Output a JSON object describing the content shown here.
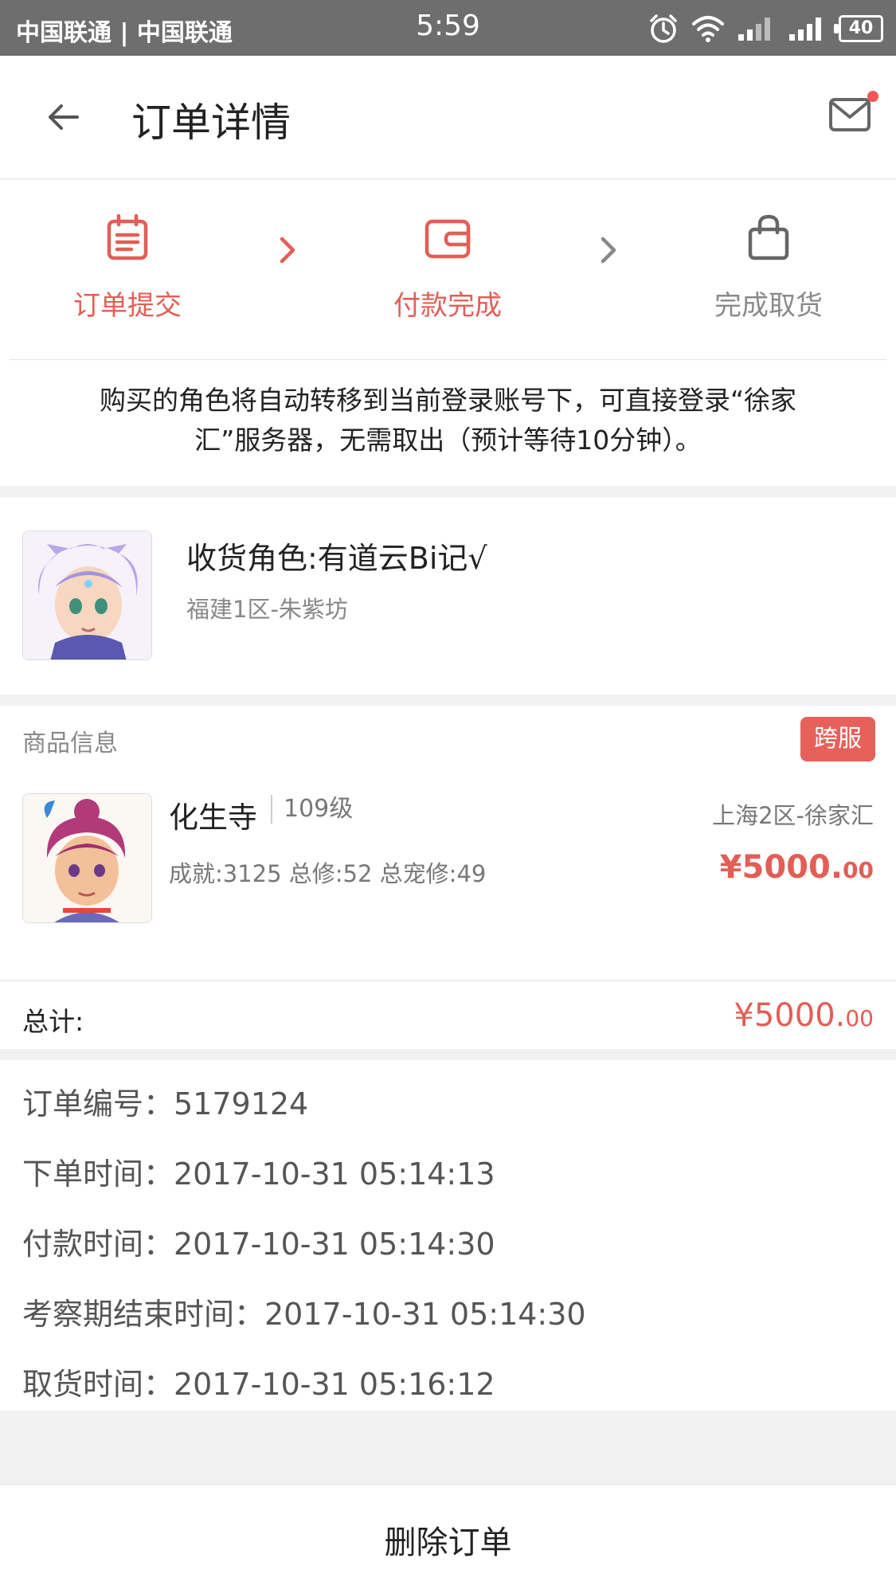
{
  "status_bar": {
    "carrier": "中国联通 | 中国联通",
    "time": "5:59",
    "battery": "40"
  },
  "header": {
    "title": "订单详情"
  },
  "steps": [
    {
      "label": "订单提交",
      "icon": "calendar-icon",
      "state": "active"
    },
    {
      "label": "付款完成",
      "icon": "wallet-icon",
      "state": "active"
    },
    {
      "label": "完成取货",
      "icon": "bag-icon",
      "state": "inactive"
    }
  ],
  "notice": {
    "line1": "购买的角色将自动转移到当前登录账号下，可直接登录“徐家",
    "line2": "汇”服务器，无需取出（预计等待10分钟）。"
  },
  "receiver": {
    "name": "收货角色:有道云Bi记√",
    "server": "福建1区-朱紫坊"
  },
  "goods": {
    "section_title": "商品信息",
    "badge": "跨服",
    "name": "化生寺",
    "level": "109级",
    "server": "上海2区-徐家汇",
    "stats": "成就:3125 总修:52 总宠修:49",
    "price_int": "¥5000.",
    "price_dec": "00"
  },
  "total": {
    "label": "总计:",
    "value_int": "¥5000.",
    "value_dec": "00"
  },
  "order_info": {
    "order_no": "订单编号：5179124",
    "order_time": "下单时间：2017-10-31 05:14:13",
    "pay_time": "付款时间：2017-10-31 05:14:30",
    "review_end_time": "考察期结束时间：2017-10-31 05:14:30",
    "pickup_time": "取货时间：2017-10-31 05:16:12"
  },
  "actions": {
    "delete_label": "删除订单"
  },
  "colors": {
    "accent": "#e25e56",
    "status_bar": "#6e6e6e"
  }
}
